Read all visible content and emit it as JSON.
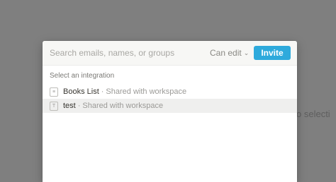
{
  "background": {
    "partial_text": "o selecti"
  },
  "share_dialog": {
    "search_placeholder": "Search emails, names, or groups",
    "permission_label": "Can edit",
    "invite_label": "Invite",
    "section_label": "Select an integration",
    "separator": "·",
    "integrations": [
      {
        "name": "Books List",
        "description": "Shared with workspace",
        "icon": "page-icon",
        "selected": false
      },
      {
        "name": "test",
        "description": "Shared with workspace",
        "icon": "page-icon",
        "selected": true
      }
    ]
  },
  "colors": {
    "overlay": "#7f7f7f",
    "accent": "#2eaadc"
  }
}
